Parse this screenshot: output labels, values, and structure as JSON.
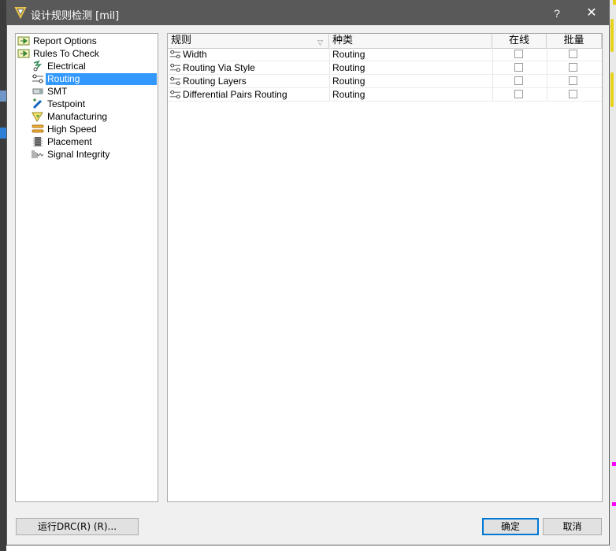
{
  "window": {
    "title": "设计规则检测 [mil]",
    "help": "?",
    "close": "✕"
  },
  "tree": {
    "items": [
      {
        "label": "Report Options",
        "icon": "report-options-icon",
        "level": 0
      },
      {
        "label": "Rules To Check",
        "icon": "rules-to-check-icon",
        "level": 0
      },
      {
        "label": "Electrical",
        "icon": "electrical-icon",
        "level": 1
      },
      {
        "label": "Routing",
        "icon": "routing-icon",
        "level": 1,
        "selected": true
      },
      {
        "label": "SMT",
        "icon": "smt-icon",
        "level": 1
      },
      {
        "label": "Testpoint",
        "icon": "testpoint-icon",
        "level": 1
      },
      {
        "label": "Manufacturing",
        "icon": "manufacturing-icon",
        "level": 1
      },
      {
        "label": "High Speed",
        "icon": "high-speed-icon",
        "level": 1
      },
      {
        "label": "Placement",
        "icon": "placement-icon",
        "level": 1
      },
      {
        "label": "Signal Integrity",
        "icon": "signal-integrity-icon",
        "level": 1
      }
    ]
  },
  "grid": {
    "headers": {
      "rule": "规则",
      "kind": "种类",
      "online": "在线",
      "batch": "批量"
    },
    "rows": [
      {
        "rule": "Width",
        "kind": "Routing",
        "online": false,
        "batch": false
      },
      {
        "rule": "Routing Via Style",
        "kind": "Routing",
        "online": false,
        "batch": false
      },
      {
        "rule": "Routing Layers",
        "kind": "Routing",
        "online": false,
        "batch": false
      },
      {
        "rule": "Differential Pairs Routing",
        "kind": "Routing",
        "online": false,
        "batch": false
      }
    ]
  },
  "buttons": {
    "run_drc": "运行DRC(R) (R)...",
    "ok": "确定",
    "cancel": "取消"
  },
  "colors": {
    "titlebar": "#595959",
    "selection": "#3399ff",
    "primary_border": "#0078d7"
  }
}
